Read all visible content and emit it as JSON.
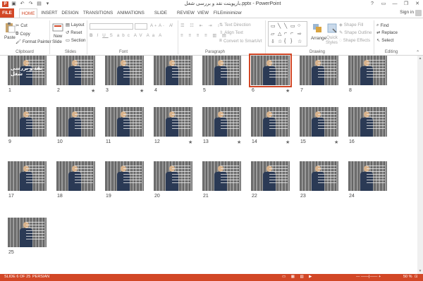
{
  "title": "بارپوینت نقد و بررسی شغل.pptx - PowerPoint",
  "quick_access": [
    "save-icon",
    "undo-icon",
    "redo-icon",
    "start-from-beginning-icon",
    "customize-icon"
  ],
  "window_controls": [
    "?",
    "▭",
    "—",
    "❐",
    "✕"
  ],
  "tabs": [
    "FILE",
    "HOME",
    "INSERT",
    "DESIGN",
    "TRANSITIONS",
    "ANIMATIONS",
    "SLIDE SHOW",
    "REVIEW",
    "VIEW",
    "FILEminimizer"
  ],
  "signin": "Sign in",
  "ribbon": {
    "clipboard": {
      "paste": "Paste",
      "cut": "Cut",
      "copy": "Copy",
      "format_painter": "Format Painter",
      "label": "Clipboard"
    },
    "slides": {
      "new_slide": "New",
      "new_slide2": "Slide",
      "layout": "Layout",
      "reset": "Reset",
      "section": "Section",
      "label": "Slides"
    },
    "font": {
      "label": "Font"
    },
    "paragraph": {
      "text_direction": "Text Direction",
      "align_text": "Align Text",
      "convert_smartart": "Convert to SmartArt",
      "label": "Paragraph"
    },
    "drawing": {
      "arrange": "Arrange",
      "quick_styles": "Quick",
      "quick_styles2": "Styles",
      "shape_fill": "Shape Fill",
      "shape_outline": "Shape Outline",
      "shape_effects": "Shape Effects",
      "label": "Drawing"
    },
    "editing": {
      "find": "Find",
      "replace": "Replace",
      "select": "Select",
      "label": "Editing"
    }
  },
  "slides": [
    {
      "n": "1",
      "star": false,
      "title_text": "نقد و بررسی شغل"
    },
    {
      "n": "2",
      "star": true
    },
    {
      "n": "3",
      "star": true
    },
    {
      "n": "4",
      "star": false
    },
    {
      "n": "5",
      "star": false
    },
    {
      "n": "6",
      "star": true,
      "selected": true
    },
    {
      "n": "7",
      "star": false
    },
    {
      "n": "8",
      "star": false
    },
    {
      "n": "9",
      "star": false
    },
    {
      "n": "10",
      "star": false
    },
    {
      "n": "11",
      "star": false
    },
    {
      "n": "12",
      "star": true
    },
    {
      "n": "13",
      "star": true
    },
    {
      "n": "14",
      "star": true
    },
    {
      "n": "15",
      "star": true
    },
    {
      "n": "16",
      "star": false
    },
    {
      "n": "17",
      "star": false
    },
    {
      "n": "18",
      "star": false
    },
    {
      "n": "19",
      "star": false
    },
    {
      "n": "20",
      "star": false
    },
    {
      "n": "21",
      "star": false
    },
    {
      "n": "22",
      "star": false
    },
    {
      "n": "23",
      "star": false
    },
    {
      "n": "24",
      "star": false
    },
    {
      "n": "25",
      "star": false
    }
  ],
  "status": {
    "slide_info": "SLIDE 6 OF 25",
    "language": "PERSIAN",
    "zoom": "50 %"
  },
  "colors": {
    "accent": "#d24726",
    "selected_outline": "#d24726"
  }
}
